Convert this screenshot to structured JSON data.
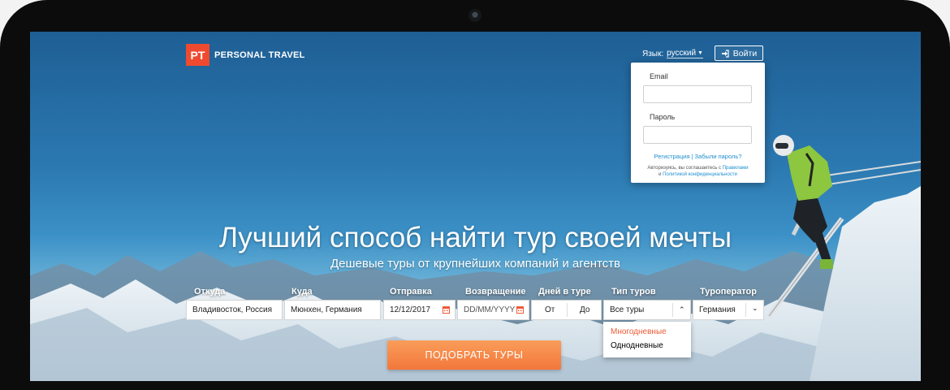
{
  "brand": {
    "badge": "PT",
    "name": "PERSONAL TRAVEL",
    "color": "#ef4a2f"
  },
  "header": {
    "language_label": "Язык:",
    "language_value": "русский",
    "login_label": "Войти",
    "login_icon": "sign-in-icon"
  },
  "login_form": {
    "email_label": "Email",
    "password_label": "Пароль",
    "register_link": "Регистрация",
    "separator": "|",
    "forgot_link": "Забыли пароль?",
    "terms_prefix": "Авторизуясь, вы соглашаетесь с",
    "rules_link": "Правилами",
    "terms_and": "и",
    "privacy_link": "Политикой конфиденциальности"
  },
  "hero": {
    "title": "Лучший способ найти тур своей мечты",
    "subtitle": "Дешевые туры от крупнейших компаний и агентств"
  },
  "search": {
    "from_label": "Откуда",
    "from_value": "Владивосток, Россия",
    "to_label": "Куда",
    "to_value": "Мюнхен, Германия",
    "depart_label": "Отправка",
    "depart_value": "12/12/2017",
    "return_label": "Возвращение",
    "return_placeholder": "DD/MM/YYYY",
    "days_label": "Дней в туре",
    "days_from": "От",
    "days_to": "До",
    "type_label": "Тип туров",
    "type_value": "Все туры",
    "type_options": [
      "Многодневные",
      "Однодневные"
    ],
    "operator_label": "Туроператор",
    "operator_value": "Германия",
    "submit_label": "ПОДОБРАТЬ ТУРЫ"
  },
  "colors": {
    "accent": "#ef5a36",
    "link": "#1e8fd0",
    "button": "#f58a45"
  }
}
